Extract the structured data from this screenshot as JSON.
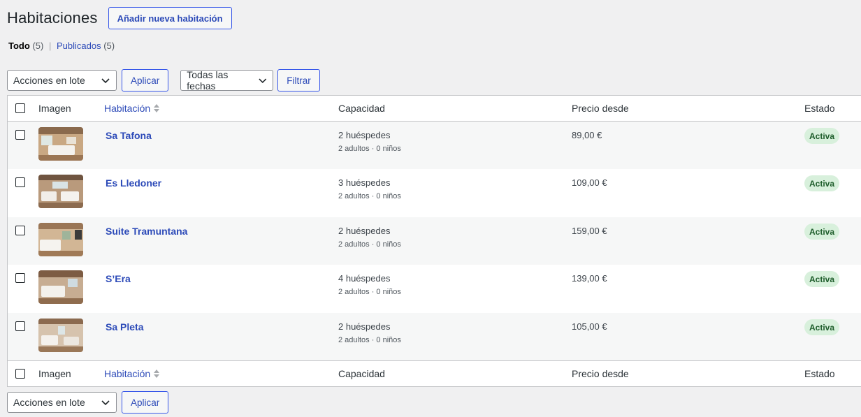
{
  "page": {
    "title": "Habitaciones",
    "add_button": "Añadir nueva habitación"
  },
  "views": {
    "all_label": "Todo",
    "all_count": "(5)",
    "separator": "|",
    "published_label": "Publicados",
    "published_count": "(5)"
  },
  "tablenav": {
    "bulk_actions": "Acciones en lote",
    "apply": "Aplicar",
    "dates": "Todas las fechas",
    "filter": "Filtrar"
  },
  "columns": {
    "image": "Imagen",
    "room": "Habitación",
    "capacity": "Capacidad",
    "price": "Precio desde",
    "status": "Estado"
  },
  "rooms": [
    {
      "name": "Sa Tafona",
      "guests": "2 huéspedes",
      "detail": "2 adultos · 0 niños",
      "price": "89,00 €",
      "status": "Activa"
    },
    {
      "name": "Es Lledoner",
      "guests": "3 huéspedes",
      "detail": "2 adultos · 0 niños",
      "price": "109,00 €",
      "status": "Activa"
    },
    {
      "name": "Suite Tramuntana",
      "guests": "2 huéspedes",
      "detail": "2 adultos · 0 niños",
      "price": "159,00 €",
      "status": "Activa"
    },
    {
      "name": "S’Era",
      "guests": "4 huéspedes",
      "detail": "2 adultos · 0 niños",
      "price": "139,00 €",
      "status": "Activa"
    },
    {
      "name": "Sa Pleta",
      "guests": "2 huéspedes",
      "detail": "2 adultos · 0 niños",
      "price": "105,00 €",
      "status": "Activa"
    }
  ],
  "colors": {
    "link": "#2c4ab8",
    "badge_bg": "#d8f0dc",
    "badge_text": "#1e5d2b"
  }
}
